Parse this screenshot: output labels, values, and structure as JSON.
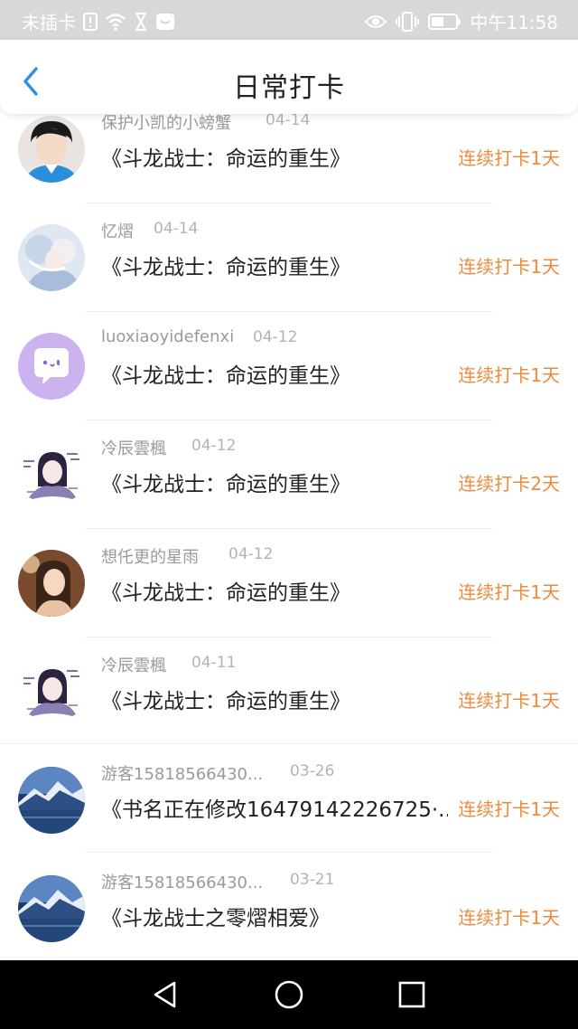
{
  "status_bar": {
    "carrier": "未插卡",
    "time": "中午11:58",
    "icons": [
      "sim-alert-icon",
      "wifi-icon",
      "hourglass-icon",
      "message-icon",
      "eye-icon",
      "vibrate-icon",
      "battery-icon"
    ]
  },
  "header": {
    "title": "日常打卡",
    "back_icon": "chevron-left-icon"
  },
  "accent_color": "#ef8a3c",
  "checkins": [
    {
      "user": "保护小凯的小螃蟹",
      "date": "04-14",
      "book": "《斗龙战士：命运的重生》",
      "streak": "连续打卡1天",
      "avatar": "photo-boy"
    },
    {
      "user": "忆熠",
      "date": "04-14",
      "book": "《斗龙战士：命运的重生》",
      "streak": "连续打卡1天",
      "avatar": "anime-white"
    },
    {
      "user": "luoxiaoyidefenxi",
      "date": "04-12",
      "book": "《斗龙战士：命运的重生》",
      "streak": "连续打卡1天",
      "avatar": "default-chat"
    },
    {
      "user": "冷辰雲楓",
      "date": "04-12",
      "book": "《斗龙战士：命运的重生》",
      "streak": "连续打卡2天",
      "avatar": "anime-purple"
    },
    {
      "user": "想仛更的星雨",
      "date": "04-12",
      "book": "《斗龙战士：命运的重生》",
      "streak": "连续打卡1天",
      "avatar": "anime-warm"
    },
    {
      "user": "冷辰雲楓",
      "date": "04-11",
      "book": "《斗龙战士：命运的重生》",
      "streak": "连续打卡1天",
      "avatar": "anime-purple"
    },
    {
      "user": "游客15818566430...",
      "date": "03-26",
      "book": "《书名正在修改16479142226725·...",
      "streak": "连续打卡1天",
      "avatar": "mountain-lake"
    },
    {
      "user": "游客15818566430...",
      "date": "03-21",
      "book": "《斗龙战士之零熠相爱》",
      "streak": "连续打卡1天",
      "avatar": "mountain-lake"
    }
  ],
  "nav_bar": {
    "icons": [
      "back-triangle-icon",
      "home-circle-icon",
      "recents-square-icon"
    ]
  }
}
